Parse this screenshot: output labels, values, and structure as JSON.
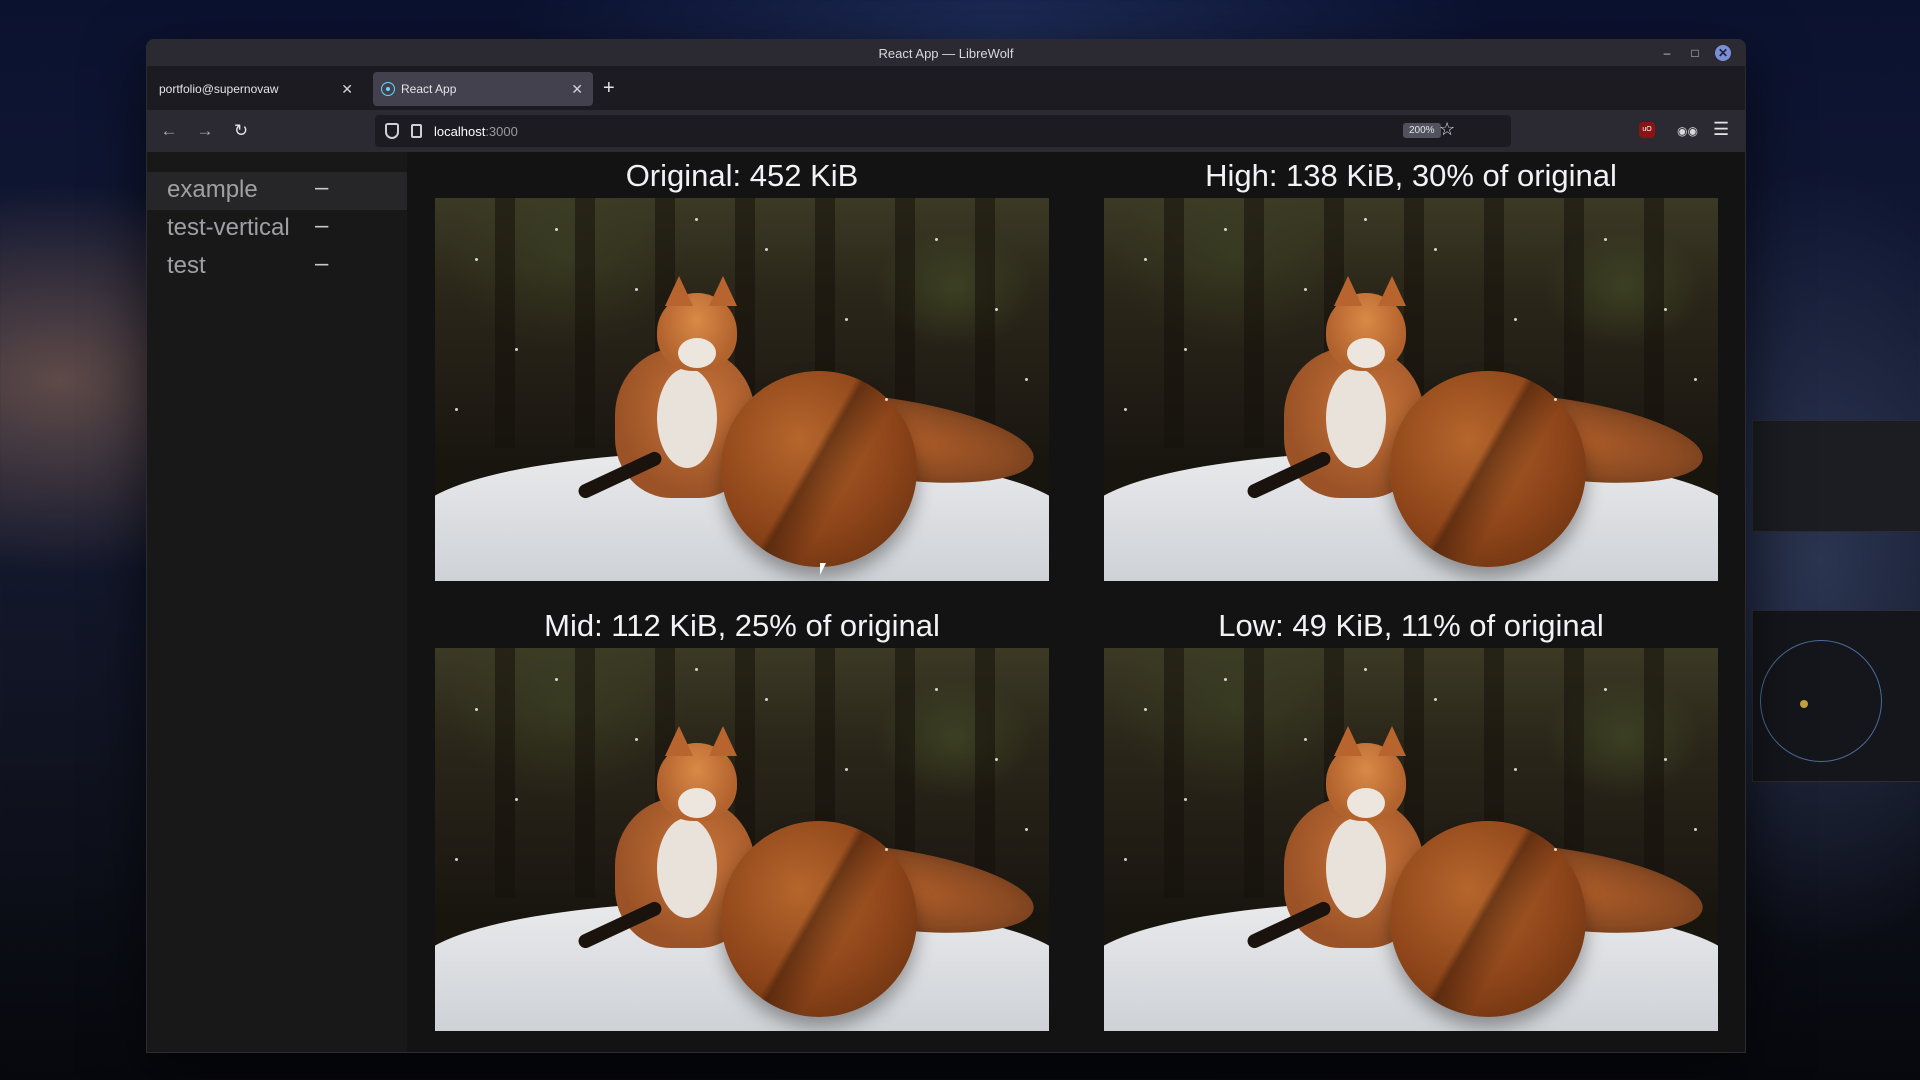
{
  "window": {
    "title": "React App — LibreWolf"
  },
  "tabs": [
    {
      "label": "portfolio@supernovaw"
    },
    {
      "label": "React App"
    }
  ],
  "nav": {
    "url_host": "localhost",
    "url_port": ":3000",
    "zoom": "200%"
  },
  "sidebar": {
    "items": [
      {
        "label": "example",
        "action": "–"
      },
      {
        "label": "test-vertical",
        "action": "–"
      },
      {
        "label": "test",
        "action": "–"
      }
    ]
  },
  "main": {
    "images": [
      {
        "caption": "Original: 452 KiB"
      },
      {
        "caption": "High: 138 KiB, 30% of original"
      },
      {
        "caption": "Mid: 112 KiB, 25% of original"
      },
      {
        "caption": "Low: 49 KiB, 11% of original"
      }
    ]
  },
  "extensions": {
    "ublock_label": "uO"
  },
  "colors": {
    "accent": "#7a8fd6",
    "react": "#61dafb",
    "ublock": "#8a1414"
  }
}
